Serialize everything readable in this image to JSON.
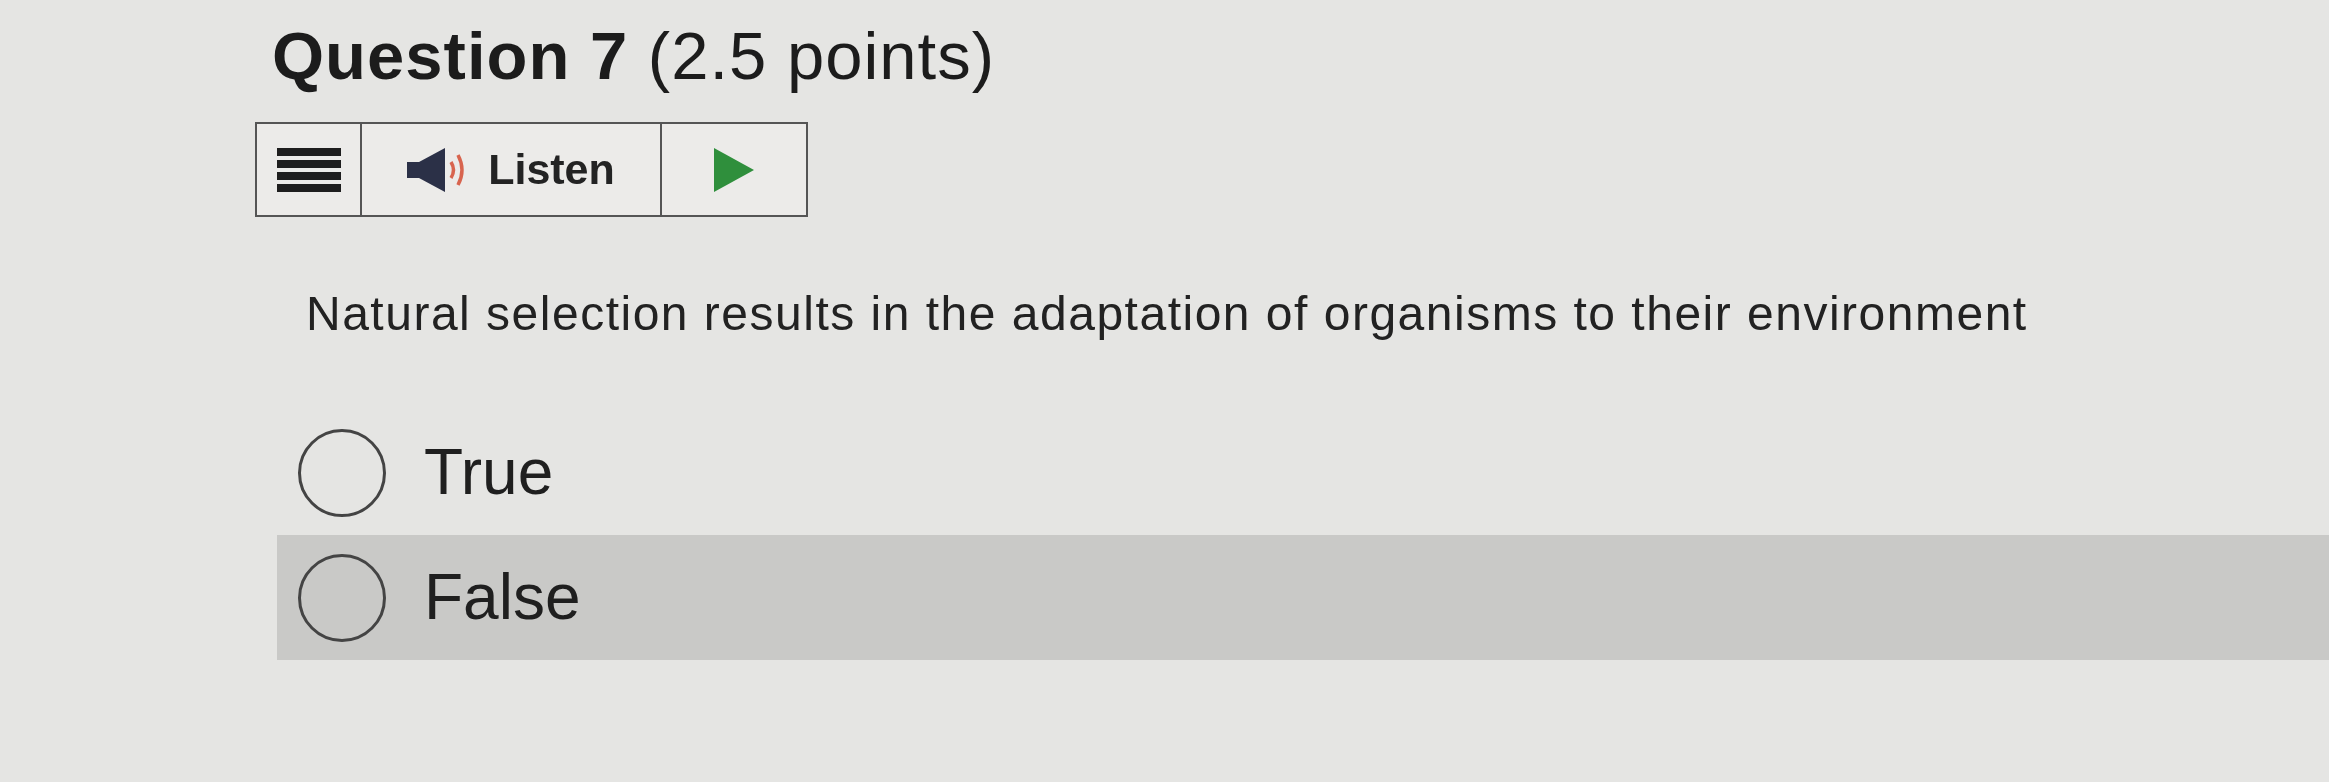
{
  "question": {
    "title": "**Question 7** (2.5 points)",
    "prompt": "Natural selection results in the adaptation of organisms to their environment"
  },
  "toolbar": [
    {
      "kind": "menu"
    },
    {
      "kind": "listen",
      "label": "Listen"
    },
    {
      "kind": "play"
    }
  ],
  "options": [
    {
      "label": "True",
      "selected": false,
      "highlighted": false
    },
    {
      "label": "False",
      "selected": false,
      "highlighted": true
    }
  ]
}
